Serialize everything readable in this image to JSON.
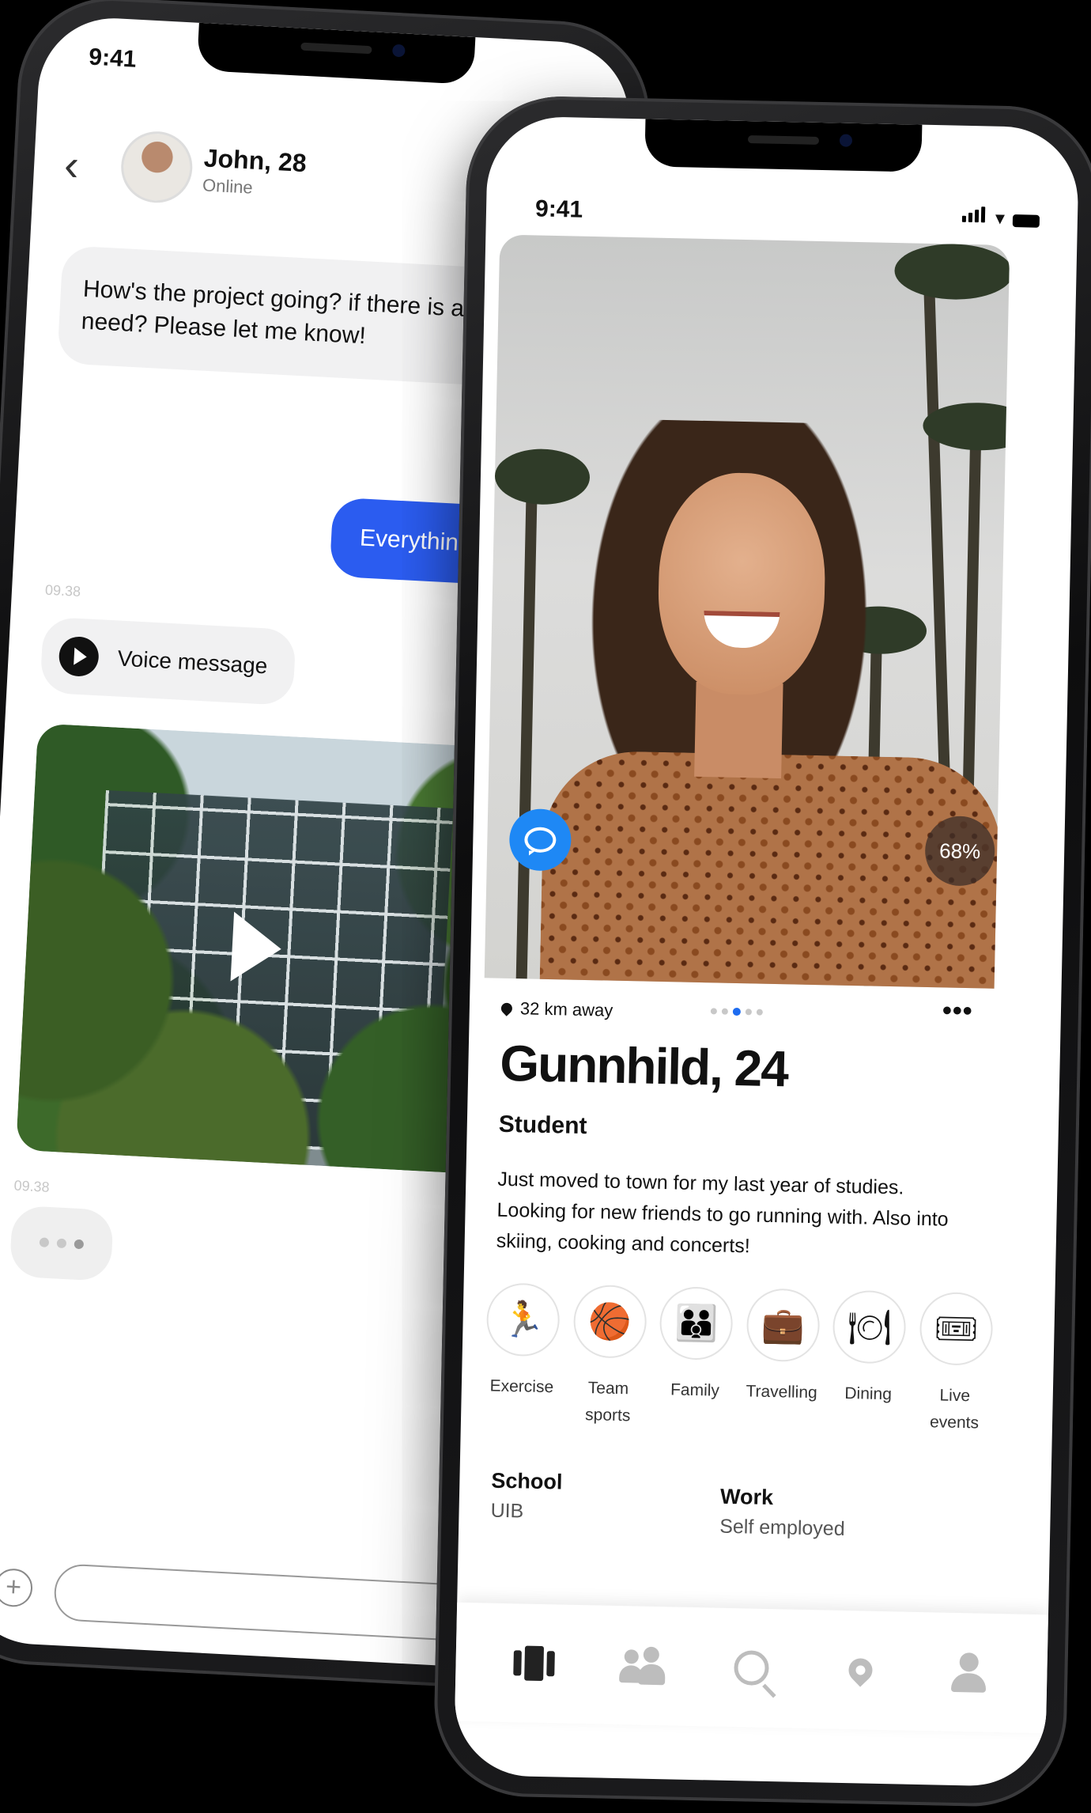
{
  "chat": {
    "status_time": "9:41",
    "contact_name": "John, 28",
    "contact_status": "Online",
    "incoming_message": "How's the project going? if there is anything you need? Please let me know!",
    "outgoing_message": "Everything is going gr",
    "timestamp_1": "09.38",
    "voice_label": "Voice message",
    "timestamp_2": "09.38",
    "composer_plus": "+"
  },
  "profile": {
    "status_time": "9:41",
    "match_percent": "68%",
    "distance": "32 km away",
    "photo_count": 5,
    "active_photo": 3,
    "more": "•••",
    "name_age": "Gunnhild, 24",
    "occupation": "Student",
    "bio": "Just moved to town for my last year of studies. Looking for new friends to go running with. Also into skiing, cooking and concerts!",
    "interests": [
      {
        "icon": "runner-icon",
        "glyph": "🏃",
        "label": "Exercise"
      },
      {
        "icon": "basketball-icon",
        "glyph": "🏀",
        "label": "Team sports"
      },
      {
        "icon": "family-icon",
        "glyph": "👪",
        "label": "Family"
      },
      {
        "icon": "suitcase-icon",
        "glyph": "💼",
        "label": "Travelling"
      },
      {
        "icon": "plate-icon",
        "glyph": "🍽",
        "label": "Dining"
      },
      {
        "icon": "ticket-icon",
        "glyph": "🎟",
        "label": "Live events"
      }
    ],
    "school_heading": "School",
    "school_value": "UIB",
    "work_heading": "Work",
    "work_value": "Self employed"
  },
  "tabbar": {
    "tabs": [
      "cards-icon",
      "people-icon",
      "search-icon",
      "location-icon",
      "user-icon"
    ],
    "active_tab": "cards-icon"
  }
}
